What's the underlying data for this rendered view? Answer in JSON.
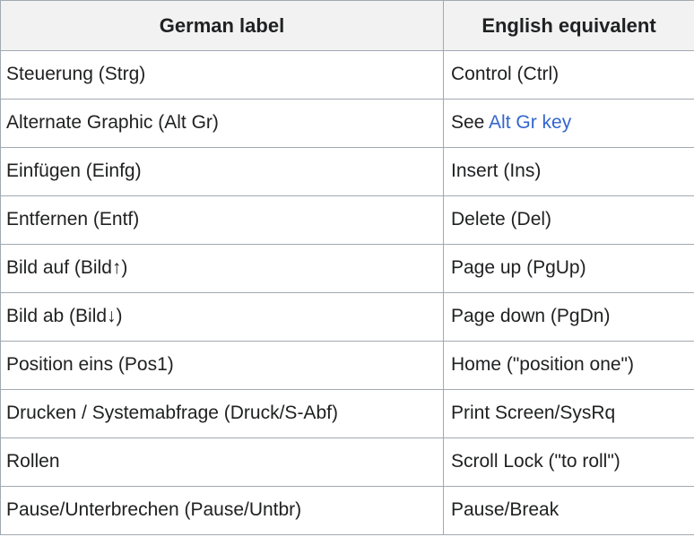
{
  "table": {
    "headers": [
      {
        "label": "German label",
        "name": "german-label"
      },
      {
        "label": "English equivalent",
        "name": "english-equivalent"
      }
    ],
    "link_color": "#3366cc",
    "header_background": "#f2f2f2",
    "border_color": "#a2a9b1",
    "rows": [
      {
        "german": "Steuerung (Strg)",
        "english": "Control (Ctrl)"
      },
      {
        "german": "Alternate Graphic (Alt Gr)",
        "english_prefix": "See ",
        "english_link": "Alt Gr key"
      },
      {
        "german": "Einfügen (Einfg)",
        "english": "Insert (Ins)"
      },
      {
        "german": "Entfernen (Entf)",
        "english": "Delete (Del)"
      },
      {
        "german": "Bild auf (Bild↑)",
        "english": "Page up (PgUp)"
      },
      {
        "german": "Bild ab (Bild↓)",
        "english": "Page down (PgDn)"
      },
      {
        "german": "Position eins (Pos1)",
        "english": "Home (\"position one\")"
      },
      {
        "german": "Drucken / Systemabfrage (Druck/S-Abf)",
        "english": "Print Screen/SysRq"
      },
      {
        "german": "Rollen",
        "english": "Scroll Lock (\"to roll\")"
      },
      {
        "german": "Pause/Unterbrechen (Pause/Untbr)",
        "english": "Pause/Break"
      }
    ]
  }
}
